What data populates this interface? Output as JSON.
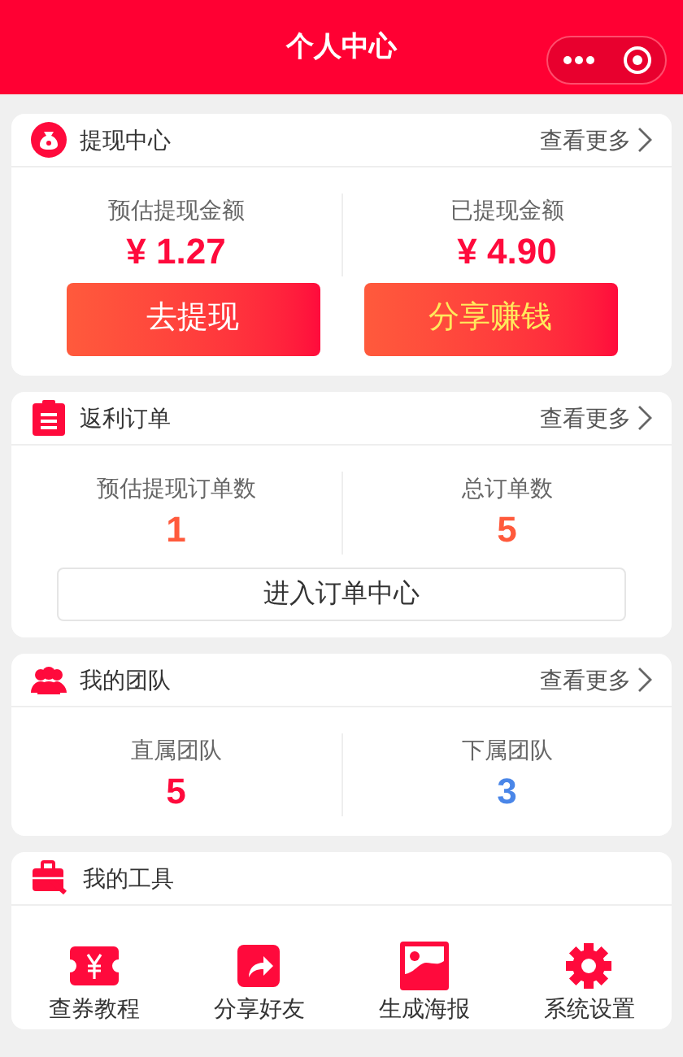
{
  "header": {
    "title": "个人中心"
  },
  "withdraw": {
    "title": "提现中心",
    "more": "查看更多",
    "stats": [
      {
        "label": "预估提现金额",
        "value": "¥ 1.27",
        "color": "#ff0a3c"
      },
      {
        "label": "已提现金额",
        "value": "¥ 4.90",
        "color": "#ff0a3c"
      }
    ],
    "buttons": [
      {
        "label": "去提现",
        "kind": "white"
      },
      {
        "label": "分享赚钱",
        "kind": "yellow"
      }
    ]
  },
  "orders": {
    "title": "返利订单",
    "more": "查看更多",
    "stats": [
      {
        "label": "预估提现订单数",
        "value": "1",
        "color": "#ff5a3c"
      },
      {
        "label": "总订单数",
        "value": "5",
        "color": "#ff5a3c"
      }
    ],
    "button": "进入订单中心"
  },
  "team": {
    "title": "我的团队",
    "more": "查看更多",
    "stats": [
      {
        "label": "直属团队",
        "value": "5",
        "color": "#ff0a3c"
      },
      {
        "label": "下属团队",
        "value": "3",
        "color": "#4a86e8"
      }
    ]
  },
  "tools": {
    "title": "我的工具",
    "items": [
      {
        "label": "查券教程",
        "kind": "ticket"
      },
      {
        "label": "分享好友",
        "kind": "share"
      },
      {
        "label": "生成海报",
        "kind": "poster"
      },
      {
        "label": "系统设置",
        "kind": "settings"
      }
    ]
  }
}
